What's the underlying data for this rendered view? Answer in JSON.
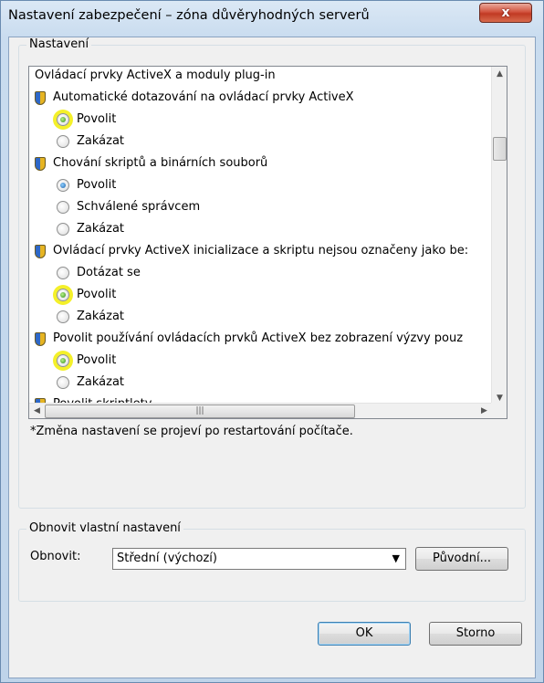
{
  "window": {
    "title": "Nastavení zabezpečení – zóna důvěryhodných serverů",
    "close_label": "x"
  },
  "settings_group": {
    "label": "Nastavení",
    "items": [
      {
        "kind": "category",
        "text": "Ovládací prvky ActiveX a moduly plug-in"
      },
      {
        "kind": "setting",
        "text": "Automatické dotazování na ovládací prvky ActiveX"
      },
      {
        "kind": "option",
        "text": "Povolit",
        "selected": true,
        "highlighted": true
      },
      {
        "kind": "option",
        "text": "Zakázat",
        "selected": false,
        "highlighted": false
      },
      {
        "kind": "setting",
        "text": "Chování skriptů a binárních souborů"
      },
      {
        "kind": "option",
        "text": "Povolit",
        "selected": true,
        "highlighted": false
      },
      {
        "kind": "option",
        "text": "Schválené správcem",
        "selected": false,
        "highlighted": false
      },
      {
        "kind": "option",
        "text": "Zakázat",
        "selected": false,
        "highlighted": false
      },
      {
        "kind": "setting",
        "text": "Ovládací prvky ActiveX inicializace a skriptu nejsou označeny jako be:"
      },
      {
        "kind": "option",
        "text": "Dotázat se",
        "selected": false,
        "highlighted": false
      },
      {
        "kind": "option",
        "text": "Povolit",
        "selected": true,
        "highlighted": true
      },
      {
        "kind": "option",
        "text": "Zakázat",
        "selected": false,
        "highlighted": false
      },
      {
        "kind": "setting",
        "text": "Povolit používání ovládacích prvků ActiveX bez zobrazení výzvy pouz"
      },
      {
        "kind": "option",
        "text": "Povolit",
        "selected": true,
        "highlighted": true
      },
      {
        "kind": "option",
        "text": "Zakázat",
        "selected": false,
        "highlighted": false
      },
      {
        "kind": "setting",
        "text": "Povolit skriptlety"
      }
    ],
    "note": "*Změna nastavení se projeví po restartování počítače."
  },
  "reset_group": {
    "label": "Obnovit vlastní nastavení",
    "reset_label": "Obnovit:",
    "reset_value": "Střední (výchozí)",
    "default_button": "Původní..."
  },
  "buttons": {
    "ok": "OK",
    "cancel": "Storno"
  },
  "colors": {
    "highlight": "#f4f02a",
    "title_bar": "#c9dcef",
    "close_button": "#c13a23"
  }
}
